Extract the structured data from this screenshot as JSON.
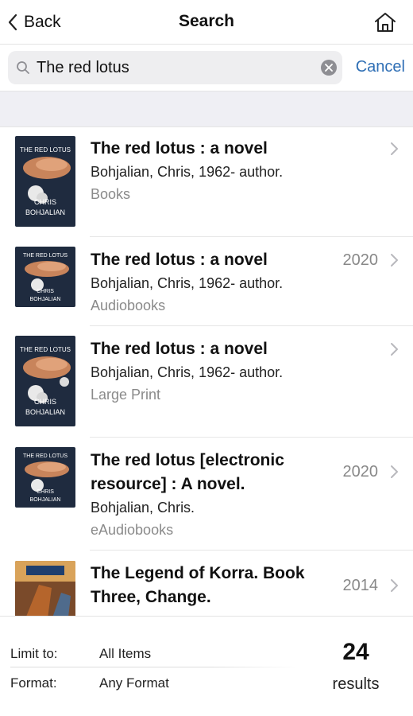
{
  "nav": {
    "back_label": "Back",
    "title": "Search"
  },
  "search": {
    "query": "The red lotus",
    "cancel_label": "Cancel"
  },
  "results": [
    {
      "title": "The red lotus : a novel",
      "author": "Bohjalian, Chris, 1962- author.",
      "format": "Books",
      "year": "",
      "cover": "red-lotus"
    },
    {
      "title": "The red lotus : a novel",
      "author": "Bohjalian, Chris, 1962- author.",
      "format": "Audiobooks",
      "year": "2020",
      "cover": "red-lotus"
    },
    {
      "title": "The red lotus : a novel",
      "author": "Bohjalian, Chris, 1962- author.",
      "format": "Large Print",
      "year": "",
      "cover": "red-lotus"
    },
    {
      "title_line1": "The red lotus [electronic",
      "title_line2": "resource] : A novel.",
      "author": "Bohjalian, Chris.",
      "format": "eAudiobooks",
      "year": "2020",
      "cover": "red-lotus"
    },
    {
      "title_line1": "The Legend of Korra. Book",
      "title_line2": "Three, Change.",
      "year": "2014",
      "cover": "korra"
    }
  ],
  "cover_text": {
    "red_lotus_title": "THE RED LOTUS",
    "red_lotus_author_1": "CHRIS",
    "red_lotus_author_2": "BOHJALIAN"
  },
  "footer": {
    "limit_label": "Limit to:",
    "limit_value": "All Items",
    "format_label": "Format:",
    "format_value": "Any Format",
    "count": "24",
    "count_label": "results"
  },
  "icons": {
    "back": "chevron-left-icon",
    "home": "home-icon",
    "search": "magnifier-icon",
    "clear": "clear-circle-icon",
    "disclosure": "chevron-right-icon"
  },
  "colors": {
    "accent": "#2f6fb5",
    "band": "#efeff4",
    "search_field": "#eeeef0",
    "secondary_text": "#8a8a8a"
  }
}
